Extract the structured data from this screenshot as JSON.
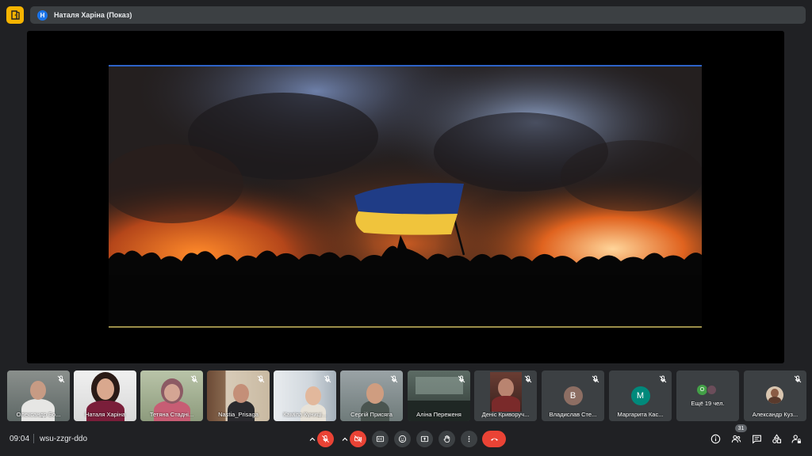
{
  "presenter": {
    "avatar_letter": "Н",
    "title": "Наталя Харіна (Показ)"
  },
  "participants": [
    {
      "name": "Олександр Бо..."
    },
    {
      "name": "Наталя Харіна"
    },
    {
      "name": "Тетяна Стадні..."
    },
    {
      "name": "Nastia_Prisaga"
    },
    {
      "name": "Каміла Куниці..."
    },
    {
      "name": "Сергій Присяга"
    },
    {
      "name": "Аліна Переженя"
    },
    {
      "name": "Деніс Криворуч..."
    },
    {
      "name": "Владислав Сте...",
      "letter": "В",
      "color": "#8d6e63"
    },
    {
      "name": "Маргарита Кас...",
      "letter": "М",
      "color": "#00897b"
    }
  ],
  "more_tile": {
    "letter": "О",
    "color": "#43a047",
    "label": "Ещё 19 чел."
  },
  "last_tile": {
    "name": "Александр Куз..."
  },
  "meeting": {
    "time": "09:04",
    "code": "wsu-zzgr-ddo"
  },
  "people_count": "31",
  "colors": {
    "accent_red": "#ea4335",
    "control_bg": "#3c4043",
    "logo": "#f6b400",
    "background": "#202124"
  }
}
